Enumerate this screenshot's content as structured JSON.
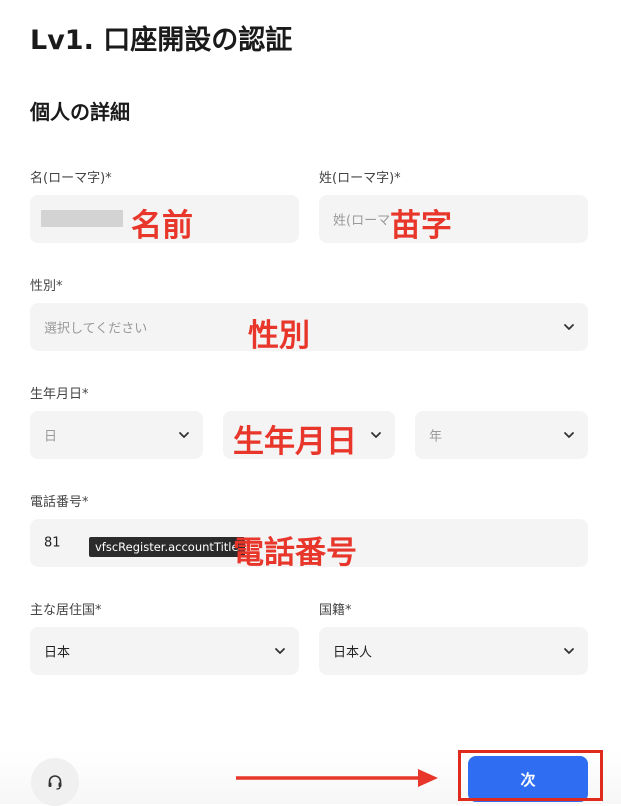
{
  "page": {
    "title": "Lv1. 口座開設の認証",
    "section_title": "個人の詳細"
  },
  "form": {
    "first_name": {
      "label": "名(ローマ字)*",
      "value": ""
    },
    "last_name": {
      "label": "姓(ローマ字)*",
      "placeholder": "姓(ローマ"
    },
    "gender": {
      "label": "性別*",
      "placeholder": "選択してください"
    },
    "birthdate": {
      "label": "生年月日*",
      "day_placeholder": "日",
      "month_placeholder": "",
      "year_placeholder": "年"
    },
    "phone": {
      "label": "電話番号*",
      "country_code": "81"
    },
    "residence": {
      "label": "主な居住国*",
      "value": "日本"
    },
    "nationality": {
      "label": "国籍*",
      "value": "日本人"
    }
  },
  "tooltip": {
    "text": "vfscRegister.accountTitle"
  },
  "annotations": {
    "first_name": "名前",
    "last_name": "苗字",
    "gender": "性別",
    "birthdate": "生年月日",
    "phone": "電話番号"
  },
  "footer": {
    "next_label": "次",
    "support_icon": "headset-icon"
  },
  "colors": {
    "annotation": "#e8362b",
    "primary_button": "#2f6ef2",
    "highlight_border": "#e02a1d"
  }
}
